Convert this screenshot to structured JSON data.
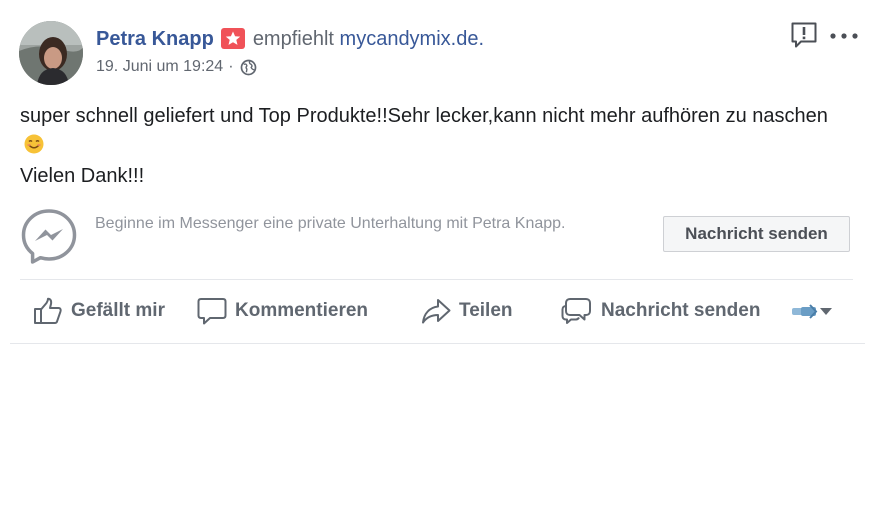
{
  "post": {
    "author": "Petra Knapp",
    "recommends_text": "empfiehlt",
    "page_name": "mycandymix.de.",
    "date": "19. Juni um 19:24",
    "separator": "·",
    "text_line1": "super schnell geliefert und Top Produkte!!Sehr lecker,kann nicht mehr aufhören zu naschen",
    "text_line2": "Vielen Dank!!!"
  },
  "messenger": {
    "prompt": "Beginne im Messenger eine private Unterhaltung mit Petra Knapp.",
    "button_label": "Nachricht senden"
  },
  "actions": {
    "like": "Gefällt mir",
    "comment": "Kommentieren",
    "share": "Teilen",
    "message": "Nachricht senden"
  },
  "icons": {
    "recommend_badge": "star-badge-icon",
    "privacy": "globe-icon",
    "report": "report-icon",
    "more": "more-dots-icon",
    "emoji": "smiling-face-emoji",
    "messenger": "messenger-icon"
  },
  "colors": {
    "link_blue": "#385898",
    "badge_red": "#f05258",
    "muted_text": "#616770",
    "action_gray": "#606770"
  }
}
